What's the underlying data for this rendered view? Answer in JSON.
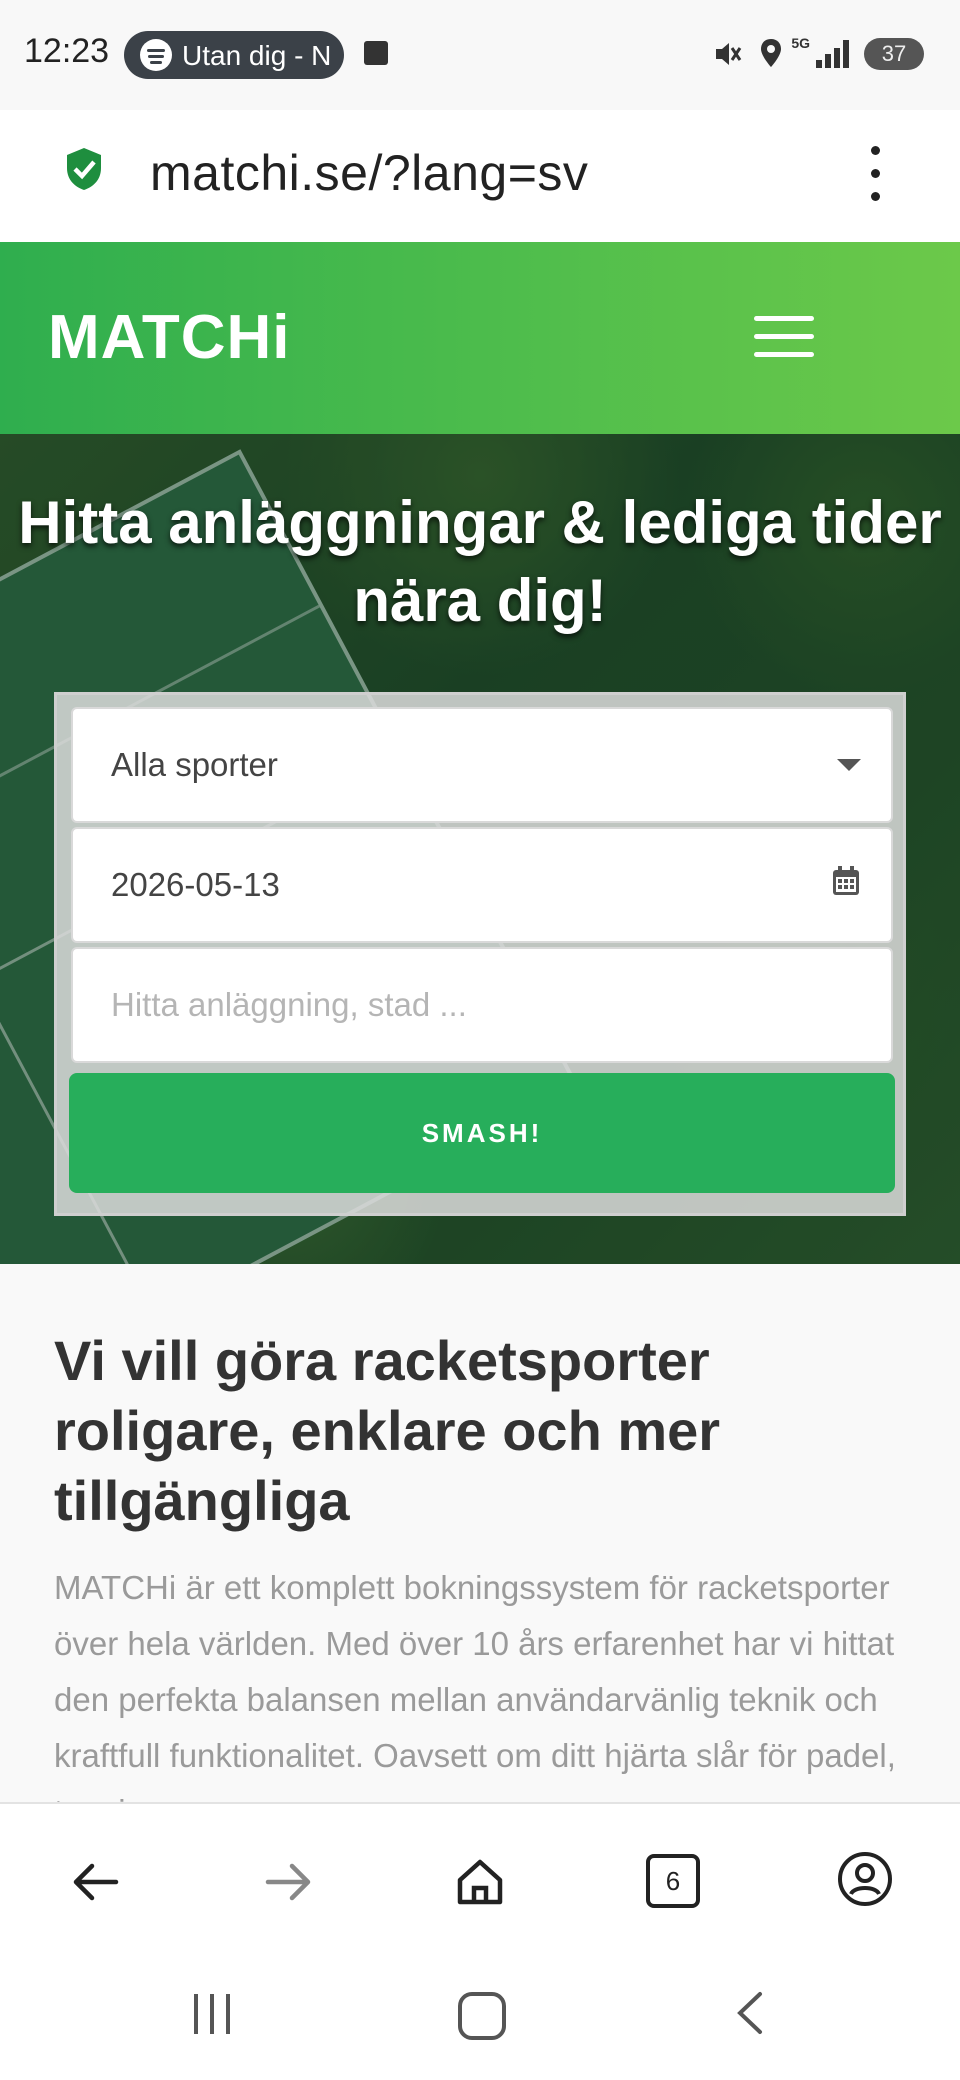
{
  "status_bar": {
    "time": "12:23",
    "media_pill": "Utan dig - N",
    "network": "5G",
    "battery": "37"
  },
  "address_bar": {
    "url": "matchi.se/?lang=sv"
  },
  "site": {
    "logo": "MATCHi",
    "accent_color": "#27ae5b"
  },
  "hero": {
    "title": "Hitta anläggningar & lediga tider nära dig!",
    "sport_select": "Alla sporter",
    "date_value": "2026-05-13",
    "search_placeholder": "Hitta anläggning, stad ...",
    "submit_label": "SMASH!"
  },
  "content": {
    "heading": "Vi vill göra racketsporter roligare, enklare och mer tillgängliga",
    "body": "MATCHi är ett komplett bokningssystem för racketsporter över hela världen. Med över 10 års erfarenhet har vi hittat den perfekta balansen mellan användarvänlig teknik och kraftfull funktionalitet. Oavsett om ditt hjärta slår för padel, tennis"
  },
  "toolbar": {
    "tabs_count": "6"
  }
}
